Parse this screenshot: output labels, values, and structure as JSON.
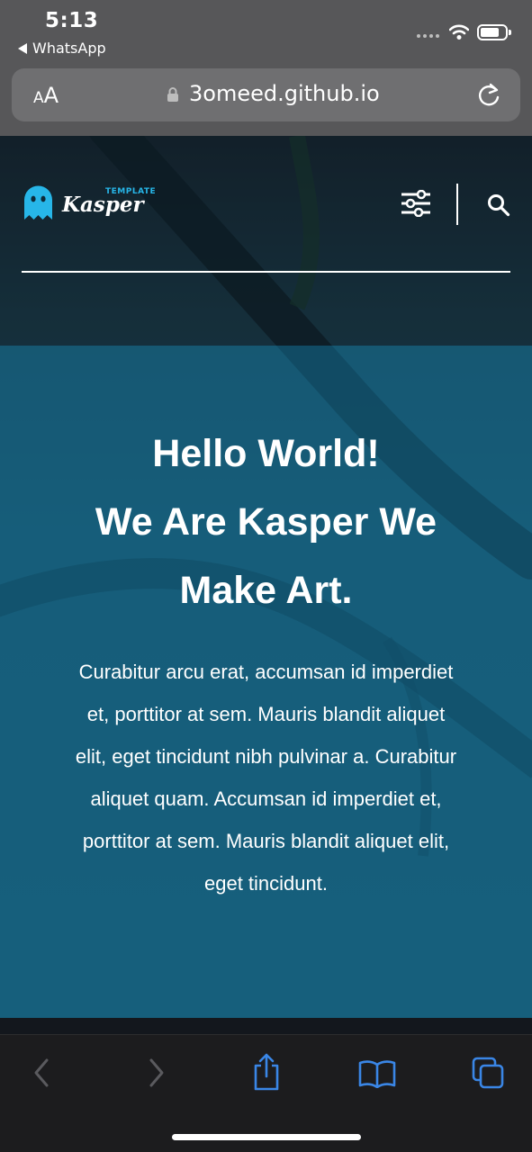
{
  "status_bar": {
    "time": "5:13",
    "back_app": "WhatsApp",
    "icons": [
      "signal-dots-icon",
      "wifi-icon",
      "battery-icon"
    ]
  },
  "browser": {
    "text_size_label_small": "A",
    "text_size_label_large": "A",
    "url": "3omeed.github.io",
    "icons": [
      "lock-icon",
      "reload-icon"
    ]
  },
  "site": {
    "logo_name": "Kasper",
    "logo_tag": "TEMPLATE",
    "nav_icons": [
      "settings-sliders-icon",
      "search-icon"
    ]
  },
  "hero": {
    "title_line1": "Hello World!",
    "title_line2": "We Are Kasper We",
    "title_line3": "Make Art.",
    "paragraph": "Curabitur arcu erat, accumsan id imperdiet et, porttitor at sem. Mauris blandit aliquet elit, eget tincidunt nibh pulvinar a. Curabitur aliquet quam. Accumsan id imperdiet et, porttitor at sem. Mauris blandit aliquet elit, eget tincidunt."
  },
  "toolbar": {
    "icons": [
      "back-icon",
      "forward-icon",
      "share-icon",
      "bookmarks-icon",
      "tabs-icon"
    ],
    "active_color": "#3a86e6",
    "disabled_color": "#5a5a5e"
  },
  "colors": {
    "logo_accent": "#27b6e8",
    "hero_overlay": "#126e91"
  }
}
